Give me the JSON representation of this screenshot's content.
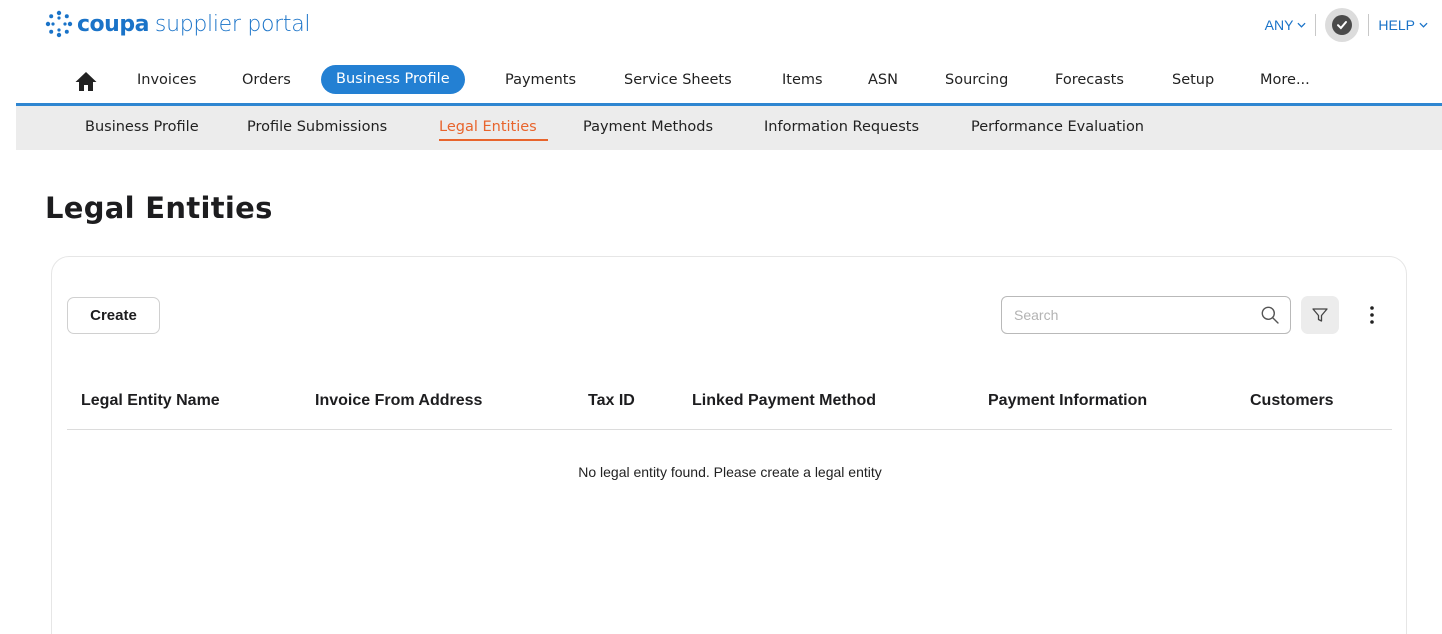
{
  "brand": {
    "logo_word": "coupa",
    "logo_rest": "supplier portal",
    "color": "#1a73c8"
  },
  "top_right": {
    "any_label": "ANY",
    "help_label": "HELP"
  },
  "main_nav": {
    "home_icon": "home-icon",
    "items": [
      {
        "label": "Invoices"
      },
      {
        "label": "Orders"
      },
      {
        "label": "Business Profile",
        "active": true
      },
      {
        "label": "Payments"
      },
      {
        "label": "Service Sheets"
      },
      {
        "label": "Items"
      },
      {
        "label": "ASN"
      },
      {
        "label": "Sourcing"
      },
      {
        "label": "Forecasts"
      },
      {
        "label": "Setup"
      },
      {
        "label": "More..."
      }
    ],
    "accent_color": "#2380d3"
  },
  "sub_nav": {
    "items": [
      {
        "label": "Business Profile"
      },
      {
        "label": "Profile Submissions"
      },
      {
        "label": "Legal Entities",
        "active": true
      },
      {
        "label": "Payment Methods"
      },
      {
        "label": "Information Requests"
      },
      {
        "label": "Performance Evaluation"
      }
    ],
    "active_color": "#e8642c"
  },
  "page": {
    "title": "Legal Entities"
  },
  "toolbar": {
    "create_label": "Create",
    "search_placeholder": "Search",
    "search_value": "",
    "filter_icon": "filter-icon",
    "more_icon": "more-vertical-icon"
  },
  "table": {
    "columns": [
      "Legal Entity Name",
      "Invoice From Address",
      "Tax ID",
      "Linked Payment Method",
      "Payment Information",
      "Customers"
    ],
    "rows": [],
    "empty_message": "No legal entity found. Please create a legal entity"
  }
}
